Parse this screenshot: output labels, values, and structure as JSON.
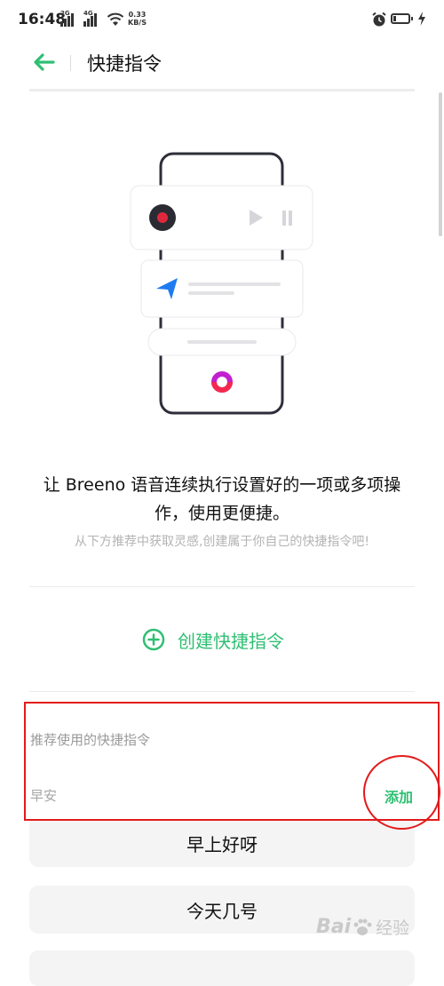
{
  "status_bar": {
    "time": "16:48",
    "signal1_tag": "2G",
    "signal2_tag": "4G",
    "net_speed_value": "0.33",
    "net_speed_unit": "KB/S"
  },
  "header": {
    "title": "快捷指令"
  },
  "intro": {
    "headline": "让 Breeno 语音连续执行设置好的一项或多项操作，使用更便捷。",
    "subtext": "从下方推荐中获取灵感,创建属于你自己的快捷指令吧!"
  },
  "create": {
    "label": "创建快捷指令"
  },
  "recommend": {
    "header": "推荐使用的快捷指令",
    "item_title": "早安",
    "add_label": "添加",
    "commands": [
      "早上好呀",
      "今天几号"
    ]
  },
  "watermark": {
    "text": "Bai",
    "sub": "经验"
  },
  "colors": {
    "accent": "#2fbf73",
    "highlight": "#e31b1b",
    "pill_bg": "#f4f4f4"
  },
  "icons": [
    "back-arrow-icon",
    "wifi-icon",
    "alarm-icon",
    "battery-icon",
    "charging-icon",
    "plus-circle-icon",
    "record-icon",
    "play-icon",
    "pause-icon",
    "navigation-arrow-icon"
  ]
}
